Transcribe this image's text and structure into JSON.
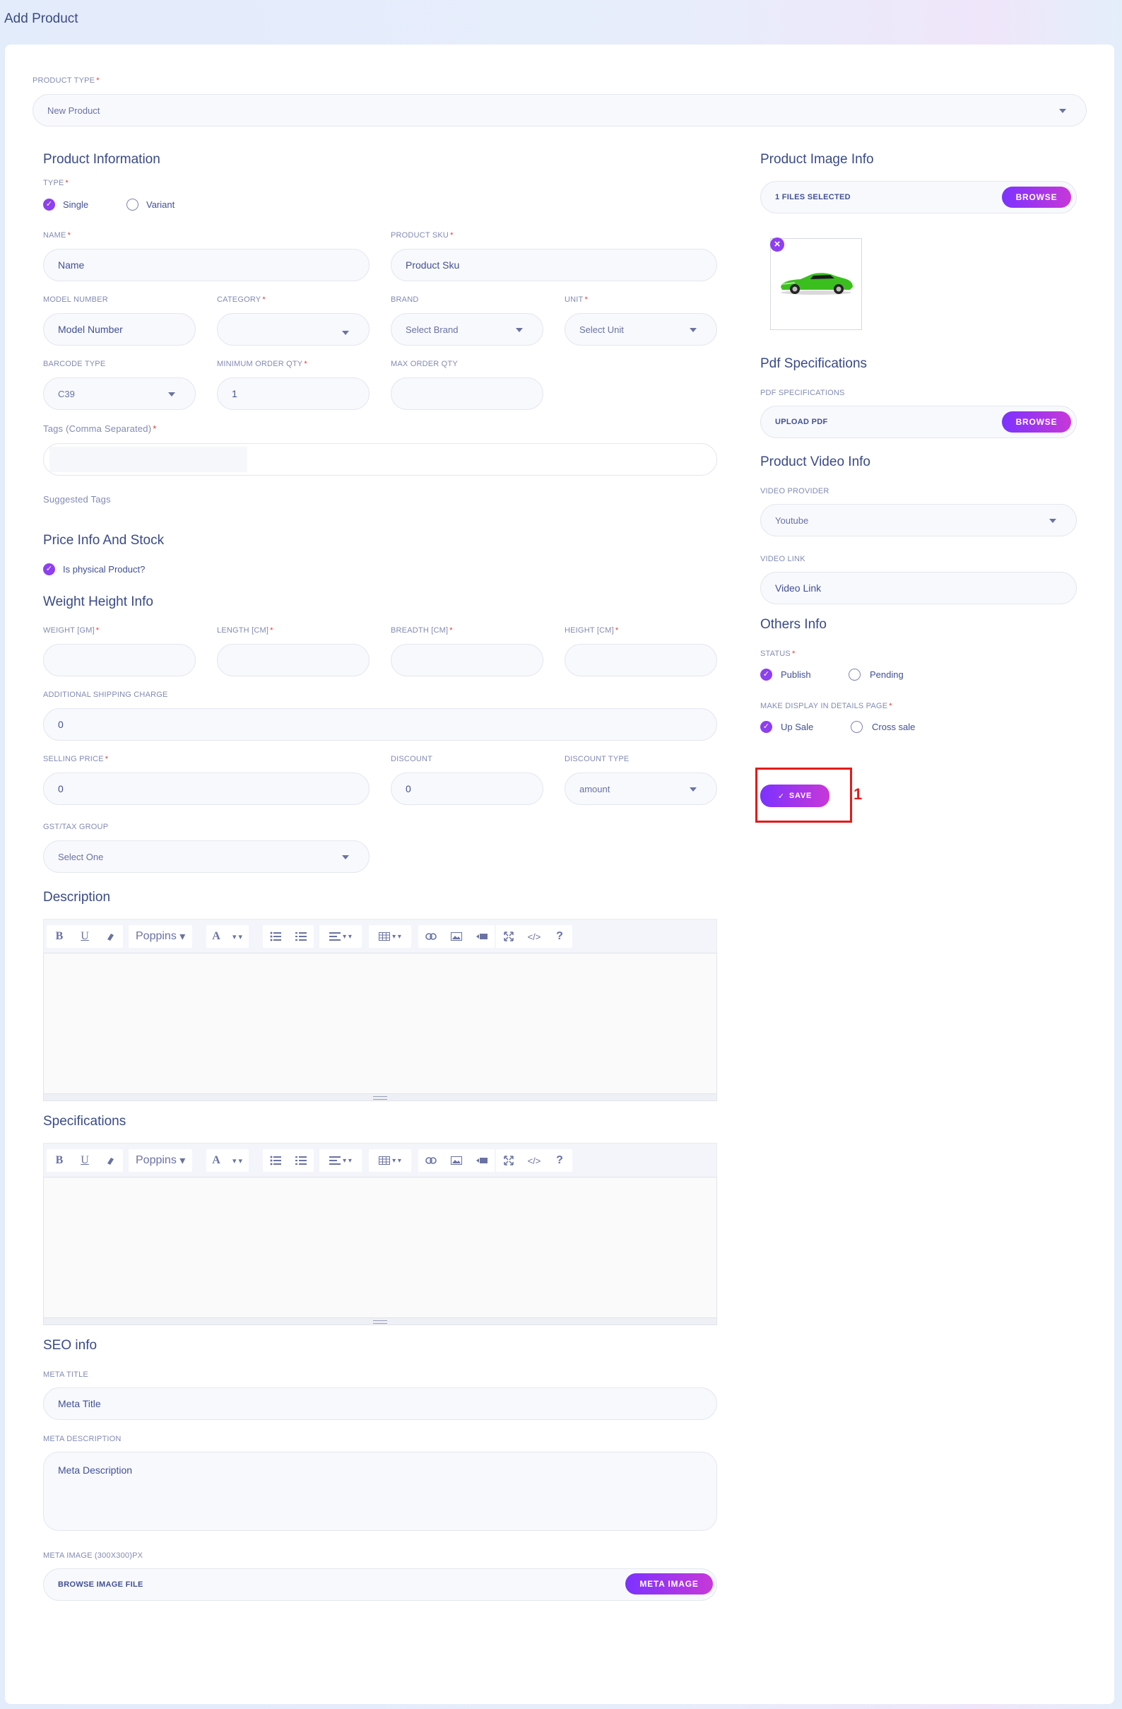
{
  "page": {
    "title": "Add Product"
  },
  "product_type": {
    "label": "PRODUCT TYPE",
    "value": "New Product"
  },
  "product_information": {
    "title": "Product Information",
    "type_label": "TYPE",
    "type_options": [
      "Single",
      "Variant"
    ],
    "name": {
      "label": "NAME",
      "placeholder": "Name"
    },
    "sku": {
      "label": "PRODUCT SKU",
      "placeholder": "Product Sku"
    },
    "model_number": {
      "label": "MODEL NUMBER",
      "placeholder": "Model Number"
    },
    "category": {
      "label": "CATEGORY",
      "value": ""
    },
    "brand": {
      "label": "BRAND",
      "value": "Select Brand"
    },
    "unit": {
      "label": "UNIT",
      "value": "Select Unit"
    },
    "barcode_type": {
      "label": "BARCODE TYPE",
      "value": "C39"
    },
    "min_order_qty": {
      "label": "MINIMUM ORDER QTY",
      "value": "1"
    },
    "max_order_qty": {
      "label": "MAX ORDER QTY",
      "value": ""
    },
    "tags": {
      "label": "Tags (Comma Separated)",
      "value": ""
    },
    "suggested_tags": "Suggested Tags"
  },
  "price_info": {
    "title": "Price Info And Stock",
    "physical_label": "Is physical Product?"
  },
  "weight_info": {
    "title": "Weight Height Info",
    "weight_label": "WEIGHT [GM]",
    "length_label": "LENGTH [CM]",
    "breadth_label": "BREADTH [CM]",
    "height_label": "HEIGHT [CM]",
    "shipping_label": "ADDITIONAL SHIPPING CHARGE",
    "shipping_value": "0",
    "selling_price_label": "SELLING PRICE",
    "selling_price_value": "0",
    "discount_label": "DISCOUNT",
    "discount_value": "0",
    "discount_type_label": "DISCOUNT TYPE",
    "discount_type_value": "amount",
    "gst_label": "GST/TAX GROUP",
    "gst_value": "Select One"
  },
  "description": {
    "title": "Description",
    "font": "Poppins"
  },
  "specifications": {
    "title": "Specifications",
    "font": "Poppins"
  },
  "seo": {
    "title": "SEO info",
    "meta_title_label": "META TITLE",
    "meta_title_placeholder": "Meta Title",
    "meta_desc_label": "META DESCRIPTION",
    "meta_desc_placeholder": "Meta Description",
    "meta_image_label": "META IMAGE (300X300)PX",
    "meta_image_text": "BROWSE IMAGE FILE",
    "meta_image_button": "META IMAGE"
  },
  "image_info": {
    "title": "Product Image Info",
    "files_text": "1 FILES SELECTED",
    "browse": "BROWSE",
    "remove": "×"
  },
  "pdf": {
    "title": "Pdf Specifications",
    "label": "PDF SPECIFICATIONS",
    "text": "UPLOAD PDF",
    "browse": "BROWSE"
  },
  "video": {
    "title": "Product Video Info",
    "provider_label": "VIDEO PROVIDER",
    "provider_value": "Youtube",
    "link_label": "VIDEO LINK",
    "link_placeholder": "Video Link"
  },
  "others": {
    "title": "Others Info",
    "status_label": "STATUS",
    "status_options": [
      "Publish",
      "Pending"
    ],
    "display_label": "MAKE DISPLAY IN DETAILS PAGE",
    "display_options": [
      "Up Sale",
      "Cross sale"
    ]
  },
  "save_button": "SAVE",
  "annotation": "1",
  "icons": {
    "checkmark": "✓",
    "bold": "B",
    "underline": "U",
    "font_color": "A",
    "help": "?",
    "code": "</>"
  },
  "colors": {
    "accent": "#8e3ff0",
    "highlight": "#e31b1b",
    "text": "#415094"
  }
}
